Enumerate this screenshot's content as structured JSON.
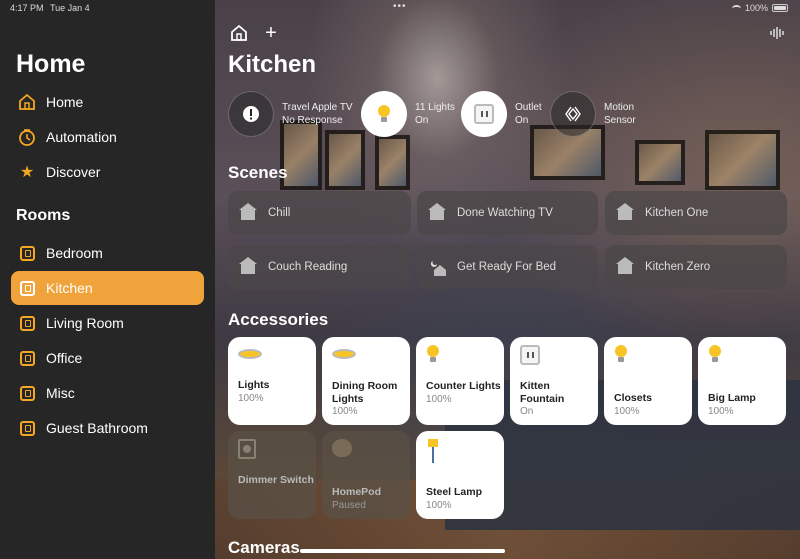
{
  "status": {
    "time": "4:17 PM",
    "date": "Tue Jan 4",
    "battery": "100%"
  },
  "sidebar": {
    "title": "Home",
    "nav": [
      {
        "label": "Home",
        "icon": "house-icon"
      },
      {
        "label": "Automation",
        "icon": "clock-icon"
      },
      {
        "label": "Discover",
        "icon": "star-icon"
      }
    ],
    "rooms_header": "Rooms",
    "rooms": [
      {
        "label": "Bedroom",
        "active": false
      },
      {
        "label": "Kitchen",
        "active": true
      },
      {
        "label": "Living Room",
        "active": false
      },
      {
        "label": "Office",
        "active": false
      },
      {
        "label": "Misc",
        "active": false
      },
      {
        "label": "Guest Bathroom",
        "active": false
      }
    ]
  },
  "main": {
    "title": "Kitchen",
    "status_items": [
      {
        "line1": "Travel Apple TV",
        "line2": "No Response",
        "icon": "alert-icon"
      },
      {
        "line1": "11 Lights",
        "line2": "On",
        "icon": "lightbulb-icon"
      },
      {
        "line1": "Outlet",
        "line2": "On",
        "icon": "outlet-icon"
      },
      {
        "line1": "Motion",
        "line2": "Sensor",
        "icon": "motion-sensor-icon"
      }
    ],
    "scenes_header": "Scenes",
    "scenes": [
      {
        "label": "Chill",
        "icon": "house-icon"
      },
      {
        "label": "Done Watching TV",
        "icon": "house-icon"
      },
      {
        "label": "Kitchen One",
        "icon": "house-icon"
      },
      {
        "label": "Couch Reading",
        "icon": "house-icon"
      },
      {
        "label": "Get Ready For Bed",
        "icon": "moon-house-icon"
      },
      {
        "label": "Kitchen Zero",
        "icon": "house-icon"
      }
    ],
    "accessories_header": "Accessories",
    "accessories": [
      {
        "name": "Lights",
        "status": "100%",
        "icon": "ceiling-light-icon",
        "on": true
      },
      {
        "name": "Dining Room Lights",
        "status": "100%",
        "icon": "ceiling-light-icon",
        "on": true
      },
      {
        "name": "Counter Lights",
        "status": "100%",
        "icon": "lightbulb-icon",
        "on": true
      },
      {
        "name": "Kitten Fountain",
        "status": "On",
        "icon": "outlet-icon",
        "on": true
      },
      {
        "name": "Closets",
        "status": "100%",
        "icon": "lightbulb-icon",
        "on": true
      },
      {
        "name": "Big Lamp",
        "status": "100%",
        "icon": "lightbulb-icon",
        "on": true
      },
      {
        "name": "Dimmer Switch",
        "status": "",
        "icon": "dimmer-switch-icon",
        "on": false
      },
      {
        "name": "HomePod",
        "status": "Paused",
        "icon": "homepod-icon",
        "on": false
      },
      {
        "name": "Steel Lamp",
        "status": "100%",
        "icon": "floor-lamp-icon",
        "on": true
      }
    ],
    "cameras_header": "Cameras"
  }
}
